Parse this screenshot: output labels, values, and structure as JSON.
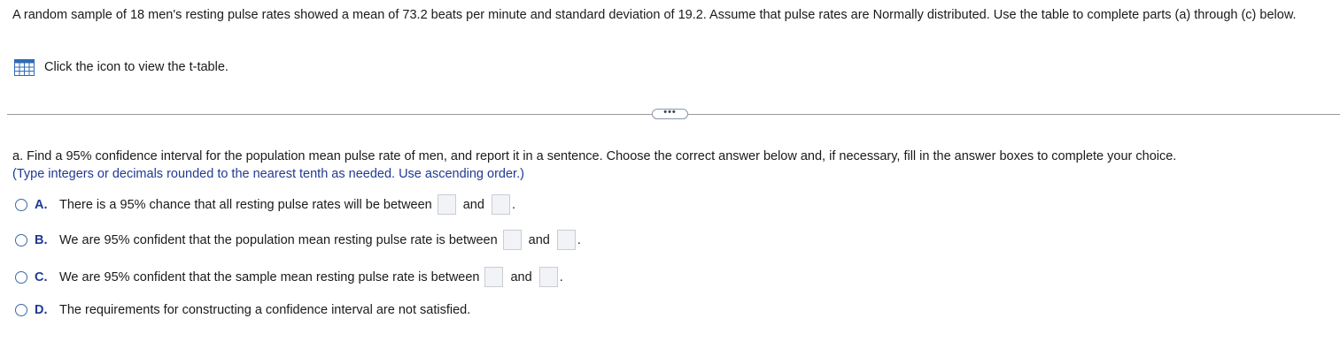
{
  "intro_text": "A random sample of 18 men's resting pulse rates showed a mean of 73.2 beats per minute and standard deviation of 19.2. Assume that pulse rates are Normally distributed. Use the table to complete parts (a) through (c) below.",
  "ttable": {
    "icon": "table-icon",
    "label": "Click the icon to view the t-table."
  },
  "expand_button": {
    "label": "•••",
    "icon": "more-dots-icon"
  },
  "question_text": "a. Find a 95% confidence interval for the population mean pulse rate of men, and report it in a sentence. Choose the correct answer below and, if necessary, fill in the answer boxes to complete your choice.",
  "instruction_text": "(Type integers or decimals rounded to the nearest tenth as needed. Use ascending order.)",
  "options": [
    {
      "letter": "A.",
      "text": "There is a 95% chance that all resting pulse rates will be between",
      "and": "and",
      "end": ".",
      "has_boxes": true
    },
    {
      "letter": "B.",
      "text": "We are 95% confident that the population mean resting pulse rate is between",
      "and": "and",
      "end": ".",
      "has_boxes": true
    },
    {
      "letter": "C.",
      "text": "We are 95% confident that the sample mean resting pulse rate is between",
      "and": "and",
      "end": ".",
      "has_boxes": true
    },
    {
      "letter": "D.",
      "text": "The requirements for constructing a confidence interval are not satisfied.",
      "has_boxes": false
    }
  ],
  "colors": {
    "instruction": "#1f3a93",
    "radio_border": "#3b6aa3",
    "divider": "#9a9a9a"
  }
}
